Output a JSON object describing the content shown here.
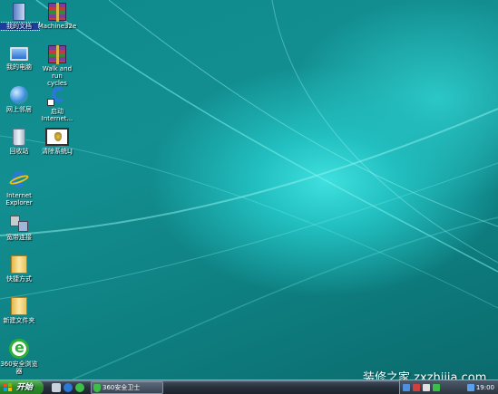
{
  "desktop": {
    "icons_left": [
      {
        "id": "my-documents",
        "label": "我的文档",
        "icon": "documents-icon",
        "selected": true
      },
      {
        "id": "my-computer",
        "label": "我的电脑",
        "icon": "computer-icon",
        "selected": false
      },
      {
        "id": "network",
        "label": "网上邻居",
        "icon": "network-globe-icon",
        "selected": false
      },
      {
        "id": "recycle-bin",
        "label": "回收站",
        "icon": "recycle-bin-icon",
        "selected": false
      },
      {
        "id": "internet-explorer",
        "label": "Internet\nExplorer",
        "icon": "internet-explorer-icon",
        "selected": false
      },
      {
        "id": "broadband",
        "label": "宽带连接",
        "icon": "network-connection-icon",
        "selected": false
      },
      {
        "id": "shortcuts",
        "label": "快捷方式",
        "icon": "folder-icon",
        "selected": false
      },
      {
        "id": "new-folder",
        "label": "新建文件夹",
        "icon": "folder-icon",
        "selected": false
      },
      {
        "id": "browser-360",
        "label": "360安全浏览\n器",
        "icon": "360-browser-icon",
        "selected": false
      }
    ],
    "icons_right": [
      {
        "id": "machine32e",
        "label": "Machine32e",
        "icon": "winrar-archive-icon"
      },
      {
        "id": "walk-run",
        "label": "Walk and run\ncycles",
        "icon": "winrar-archive-icon"
      },
      {
        "id": "launch-ie",
        "label": "启动\nInternet...",
        "icon": "internet-explorer-shortcut-icon"
      },
      {
        "id": "cleanup",
        "label": "清除系统LJ",
        "icon": "system-cleanup-icon"
      }
    ]
  },
  "taskbar": {
    "start_label": "开始",
    "tasks": [
      {
        "label": "360安全卫士",
        "icon": "360-safeguard-shield-icon"
      }
    ],
    "clock": "19:00",
    "colors": {
      "start": "#2f8a2f",
      "bar": "#27303b"
    }
  },
  "watermark": "装修之家 zxzhijia.com"
}
